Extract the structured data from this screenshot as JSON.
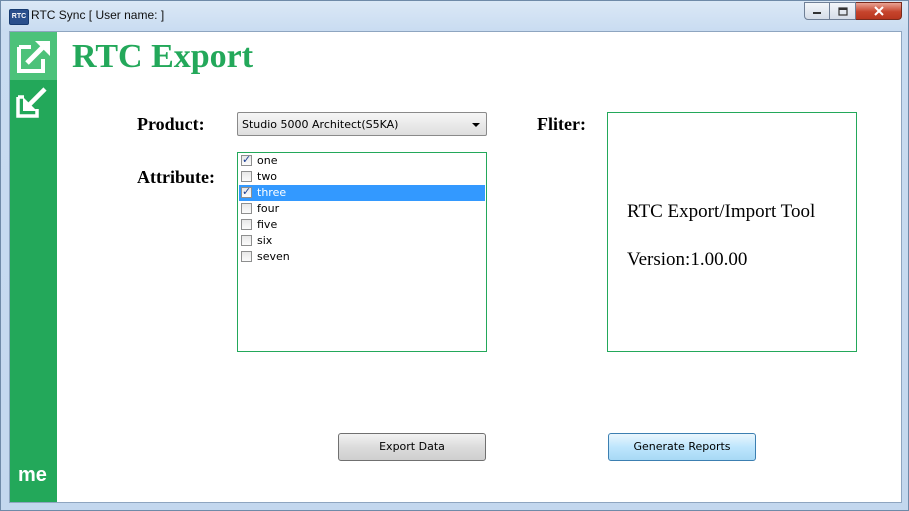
{
  "window": {
    "title": "RTC Sync [ User name:  ]",
    "app_icon_text": "RTC"
  },
  "sidebar": {
    "export_icon": "export-arrow-icon",
    "import_icon": "import-arrow-icon",
    "footer_text": "me"
  },
  "page": {
    "title": "RTC Export"
  },
  "product": {
    "label": "Product:",
    "selected": "Studio 5000 Architect(S5KA)"
  },
  "attribute": {
    "label": "Attribute:",
    "items": [
      {
        "label": "one",
        "checked": true,
        "selected": false
      },
      {
        "label": "two",
        "checked": false,
        "selected": false
      },
      {
        "label": "three",
        "checked": true,
        "selected": true
      },
      {
        "label": "four",
        "checked": false,
        "selected": false
      },
      {
        "label": "five",
        "checked": false,
        "selected": false
      },
      {
        "label": "six",
        "checked": false,
        "selected": false
      },
      {
        "label": "seven",
        "checked": false,
        "selected": false
      }
    ]
  },
  "filter": {
    "label": "Fliter:",
    "tool_name": "RTC Export/Import Tool",
    "version": "Version:1.00.00"
  },
  "buttons": {
    "export": "Export Data",
    "reports": "Generate Reports"
  },
  "colors": {
    "accent_green": "#23a85a",
    "selection_blue": "#3399ff"
  }
}
